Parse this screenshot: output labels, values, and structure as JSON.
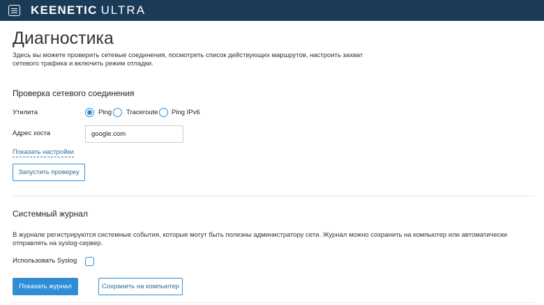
{
  "brand": {
    "name_bold": "KEENETIC",
    "name_light": "ULTRA"
  },
  "page": {
    "title": "Диагностика",
    "description": "Здесь вы можете проверить сетевые соединения, посмотреть список действующих маршрутов, настроить захват сетевого трафика и включить режим отладки."
  },
  "connection_check": {
    "title": "Проверка сетевого соединения",
    "utility_label": "Утилита",
    "options": [
      {
        "label": "Ping",
        "checked": true
      },
      {
        "label": "Traceroute",
        "checked": false
      },
      {
        "label": "Ping IPv6",
        "checked": false
      }
    ],
    "host_label": "Адрес хоста",
    "host_value": "google.com",
    "show_settings_link": "Показать настройки",
    "run_button": "Запустить проверку"
  },
  "system_log": {
    "title": "Системный журнал",
    "description": "В журнале регистрируются системные события, которые могут быть полезны администратору сети. Журнал можно сохранить на компьютер или автоматически отправлять на syslog-сервер.",
    "syslog_label": "Использовать Syslog",
    "syslog_checked": false,
    "show_log_button": "Показать журнал",
    "save_button": "Сохранить на компьютер"
  },
  "colors": {
    "header_bg": "#1b3a57",
    "accent": "#2d8ed6",
    "link": "#2d6e9e"
  },
  "icons": {
    "menu": "hamburger-menu-icon"
  }
}
